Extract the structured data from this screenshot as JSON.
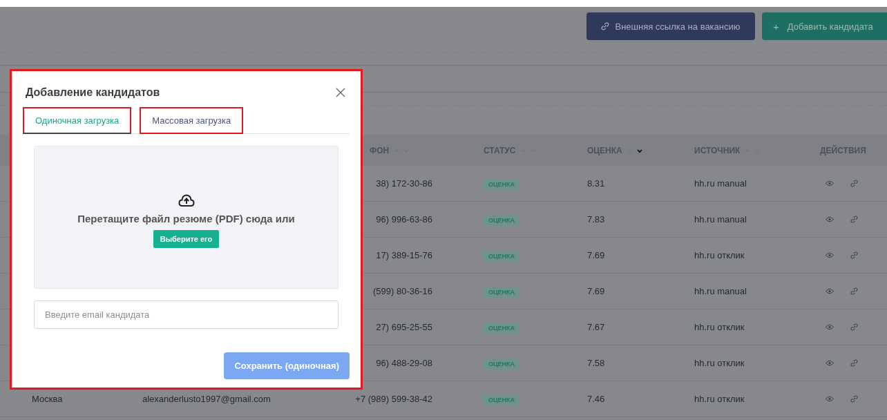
{
  "toolbar": {
    "buttons": [
      {
        "kind": "link",
        "label": "Внешняя ссылка на вакансию"
      },
      {
        "kind": "add",
        "icon": "+",
        "label": "Добавить кандидата"
      }
    ]
  },
  "table": {
    "columns": [
      {
        "label": "ФОН",
        "sorted_desc": false
      },
      {
        "label": "СТАТУС",
        "sorted_desc": false
      },
      {
        "label": "ОЦЕНКА",
        "sorted_desc": true
      },
      {
        "label": "ИСТОЧНИК",
        "sorted_desc": false
      },
      {
        "label": "ДЕЙСТВИЯ"
      }
    ],
    "rows": [
      {
        "phone": "38) 172-30-86",
        "status": "ОЦЕНКА",
        "score": "8.31",
        "source": "hh.ru manual"
      },
      {
        "phone": "96) 996-63-86",
        "status": "ОЦЕНКА",
        "score": "7.83",
        "source": "hh.ru manual"
      },
      {
        "phone": "17) 389-15-76",
        "status": "ОЦЕНКА",
        "score": "7.69",
        "source": "hh.ru отклик"
      },
      {
        "phone": "(599) 80-36-16",
        "status": "ОЦЕНКА",
        "score": "7.69",
        "source": "hh.ru manual"
      },
      {
        "phone": "27) 695-25-55",
        "status": "ОЦЕНКА",
        "score": "7.67",
        "source": "hh.ru отклик"
      },
      {
        "phone": "96) 488-29-08",
        "status": "ОЦЕНКА",
        "score": "7.58",
        "source": "hh.ru отклик"
      },
      {
        "city": "Москва",
        "email": "alexanderlusto1997@gmail.com",
        "phone": "+7 (989) 599-38-42",
        "status": "ОЦЕНКА",
        "score": "7.46",
        "source": "hh.ru отклик"
      }
    ]
  },
  "modal": {
    "title": "Добавление кандидатов",
    "tabs": [
      {
        "label": "Одиночная загрузка",
        "selected": true
      },
      {
        "label": "Массовая загрузка",
        "selected": false
      }
    ],
    "dropzone": {
      "text": "Перетащите файл резюме (PDF) сюда или",
      "button": "Выберите его"
    },
    "email_field": {
      "placeholder": "Введите email кандидата"
    },
    "save_button": {
      "label": "Сохранить (одиночная)",
      "disabled": true
    }
  }
}
